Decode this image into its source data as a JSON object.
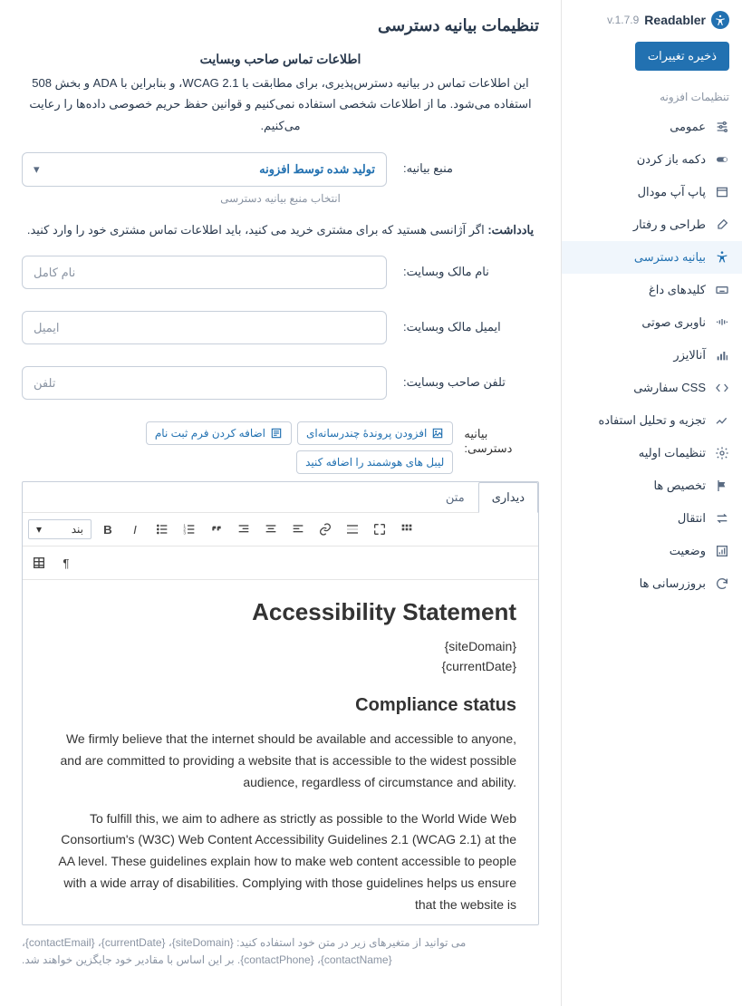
{
  "brand": {
    "name": "Readabler",
    "version": "v.1.7.9"
  },
  "actions": {
    "save": "ذخیره تغییرات"
  },
  "sidebar": {
    "section_title": "تنظیمات افزونه",
    "items": [
      {
        "label": "عمومی",
        "icon": "sliders"
      },
      {
        "label": "دکمه باز کردن",
        "icon": "toggle"
      },
      {
        "label": "پاپ آپ مودال",
        "icon": "window"
      },
      {
        "label": "طراحی و رفتار",
        "icon": "brush"
      },
      {
        "label": "بیانیه دسترسی",
        "icon": "accessibility",
        "active": true
      },
      {
        "label": "کلیدهای داغ",
        "icon": "keyboard"
      },
      {
        "label": "ناوبری صوتی",
        "icon": "sound"
      },
      {
        "label": "آنالایزر",
        "icon": "chart"
      },
      {
        "label": "CSS سفارشی",
        "icon": "code"
      },
      {
        "label": "تجزیه و تحلیل استفاده",
        "icon": "trend"
      },
      {
        "label": "تنظیمات اولیه",
        "icon": "gear"
      },
      {
        "label": "تخصیص ها",
        "icon": "flag"
      },
      {
        "label": "انتقال",
        "icon": "transfer"
      },
      {
        "label": "وضعیت",
        "icon": "status"
      },
      {
        "label": "بروزرسانی ها",
        "icon": "refresh"
      }
    ]
  },
  "page": {
    "title": "تنظیمات بیانیه دسترسی",
    "contact_heading": "اطلاعات تماس صاحب وبسایت",
    "intro": "این اطلاعات تماس در بیانیه دسترس‌پذیری، برای مطابقت با WCAG 2.1، و بنابراین با ADA و بخش 508 استفاده می‌شود. ما از اطلاعات شخصی استفاده نمی‌کنیم و قوانین حفظ حریم خصوصی داده‌ها را رعایت می‌کنیم.",
    "source_label": "منبع بیانیه:",
    "source_value": "تولید شده توسط افزونه",
    "source_helper": "انتخاب منبع بیانیه دسترسی",
    "note_strong": "یادداشت:",
    "note_text": " اگر آژانسی هستید که برای مشتری خرید می کنید، باید اطلاعات تماس مشتری خود را وارد کنید.",
    "owner_name_label": "نام مالک وبسایت:",
    "owner_name_ph": "نام کامل",
    "owner_email_label": "ایمیل مالک وبسایت:",
    "owner_email_ph": "ایمیل",
    "owner_phone_label": "تلفن صاحب وبسایت:",
    "owner_phone_ph": "تلفن",
    "statement_label": "بیانیه دسترسی:",
    "btn_media": "افزودن پروندهٔ چندرسانه‌ای",
    "btn_form": "اضافه کردن فرم ثبت نام",
    "btn_labels": "لیبل های هوشمند را اضافه کنید",
    "tabs": {
      "visual": "دیداری",
      "text": "متن"
    },
    "format_label": "بند",
    "vars_note": "می توانید از متغیرهای زیر در متن خود استفاده کنید: {siteDomain}، {currentDate}، {contactEmail}، {contactName}، {contactPhone}. بر این اساس با مقادیر خود جایگزین خواهند شد."
  },
  "editor_content": {
    "h1": "Accessibility Statement",
    "ph1": "{siteDomain}",
    "ph2": "{currentDate}",
    "h2": "Compliance status",
    "p1": "We firmly believe that the internet should be available and accessible to anyone, and are committed to providing a website that is accessible to the widest possible audience, regardless of circumstance and ability.",
    "p2": "To fulfill this, we aim to adhere as strictly as possible to the World Wide Web Consortium's (W3C) Web Content Accessibility Guidelines 2.1 (WCAG 2.1) at the AA level. These guidelines explain how to make web content accessible to people with a wide array of disabilities. Complying with those guidelines helps us ensure that the website is"
  }
}
